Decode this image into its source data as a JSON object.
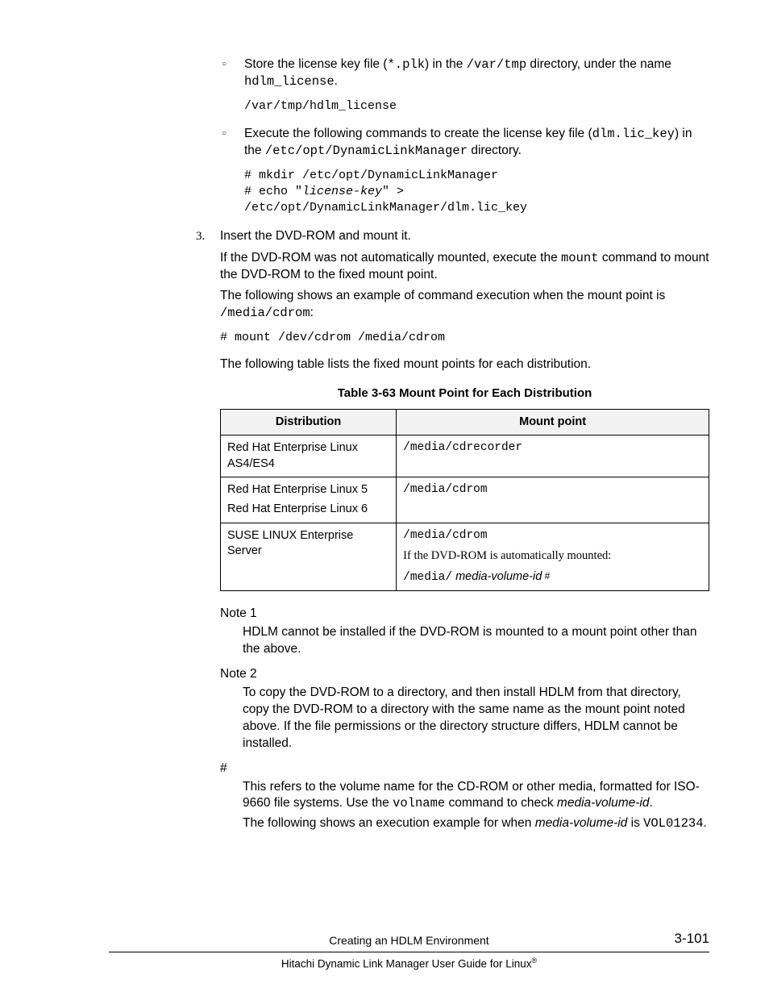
{
  "bullets": {
    "b1": {
      "prefix": "Store the license key file (",
      "code1": "*.plk",
      "mid1": ") in the ",
      "code2": "/var/tmp",
      "mid2": " directory, under the name ",
      "code3": "hdlm_license",
      "suffix": ".",
      "pre": "/var/tmp/hdlm_license"
    },
    "b2": {
      "prefix": "Execute the following commands to create the license key file (",
      "code1": "dlm.lic_key",
      "mid1": ") in the ",
      "code2": "/etc/opt/DynamicLinkManager",
      "suffix": " directory.",
      "pre_l1": "# mkdir /etc/opt/DynamicLinkManager",
      "pre_l2a": "# echo \"",
      "pre_l2b": "license-key",
      "pre_l2c": "\" >",
      "pre_l3": "/etc/opt/DynamicLinkManager/dlm.lic_key"
    }
  },
  "step3": {
    "num": "3.",
    "l1": "Insert the DVD-ROM and mount it.",
    "l2a": "If the DVD-ROM was not automatically mounted, execute the ",
    "l2code": "mount",
    "l2b": " command to mount the DVD-ROM to the fixed mount point.",
    "l3a": "The following shows an example of command execution when the mount point is ",
    "l3code": "/media/cdrom",
    "l3b": ":",
    "pre": "# mount /dev/cdrom /media/cdrom",
    "l4": "The following table lists the fixed mount points for each distribution."
  },
  "table": {
    "caption": "Table 3-63 Mount Point for Each Distribution",
    "h1": "Distribution",
    "h2": "Mount point",
    "r1c1": "Red Hat Enterprise Linux AS4/ES4",
    "r1c2": "/media/cdrecorder",
    "r2c1a": "Red Hat Enterprise Linux 5",
    "r2c1b": "Red Hat Enterprise Linux 6",
    "r2c2": "/media/cdrom",
    "r3c1": "SUSE LINUX Enterprise Server",
    "r3c2a": "/media/cdrom",
    "r3c2b": "If the DVD-ROM is automatically mounted:",
    "r3c2c1": "/media/",
    "r3c2c2": " media-volume-id",
    "r3c2hash": " #"
  },
  "notes": {
    "n1label": "Note 1",
    "n1body": "HDLM cannot be installed if the DVD-ROM is mounted to a mount point other than the above.",
    "n2label": "Note 2",
    "n2body": "To copy the DVD-ROM to a directory, and then install HDLM from that directory, copy the DVD-ROM to a directory with the same name as the mount point noted above. If the file permissions or the directory structure differs, HDLM cannot be installed.",
    "hlabel": "#",
    "hbody1a": "This refers to the volume name for the CD-ROM or other media, formatted for ISO-9660 file systems. Use the ",
    "hbody1code": "volname",
    "hbody1b": " command to check ",
    "hbody1i": "media-volume-id",
    "hbody1c": ".",
    "hbody2a": "The following shows an execution example for when ",
    "hbody2i": "media-volume-id",
    "hbody2b": " is ",
    "hbody2code": "VOL01234",
    "hbody2c": "."
  },
  "footer": {
    "title": "Creating an HDLM Environment",
    "page": "3-101",
    "guide": "Hitachi Dynamic Link Manager User Guide for Linux",
    "reg": "®"
  }
}
